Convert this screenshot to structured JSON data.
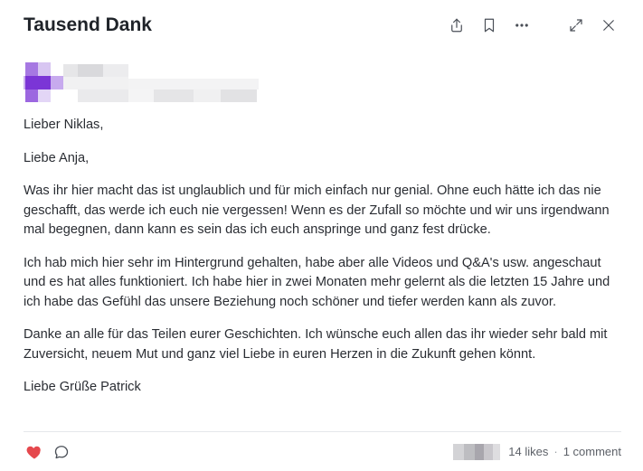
{
  "post": {
    "title": "Tausend Dank",
    "greetings": [
      "Lieber Niklas,",
      "Liebe Anja,"
    ],
    "paragraphs": [
      "Was ihr hier macht das ist unglaublich und für mich einfach nur genial. Ohne euch hätte ich das nie geschafft, das werde ich euch nie vergessen! Wenn es der Zufall so möchte und wir uns irgendwann mal begegnen, dann kann es sein das ich euch anspringe und ganz fest drücke.",
      "Ich hab mich hier sehr im Hintergrund gehalten, habe aber alle Videos und Q&A's usw. angeschaut und es hat alles funktioniert. Ich habe hier in zwei Monaten mehr gelernt als die letzten 15 Jahre und ich habe das Gefühl das unsere Beziehung noch schöner und tiefer werden kann als zuvor.",
      "Danke an alle für das Teilen eurer Geschichten. Ich wünsche euch allen das ihr wieder sehr bald mit Zuversicht, neuem Mut und ganz viel Liebe in euren Herzen in die Zukunft gehen könnt."
    ],
    "signoff": "Liebe Grüße Patrick"
  },
  "header": {
    "icons": [
      "share-icon",
      "bookmark-icon",
      "more-icon",
      "expand-icon",
      "close-icon"
    ]
  },
  "footer": {
    "likes": "14 likes",
    "separator": "·",
    "comments": "1 comment",
    "icons": [
      "heart-icon",
      "comment-icon"
    ]
  },
  "colors": {
    "accent_purple": "#7b35d6",
    "like_red": "#e5484d",
    "text": "#2a2d33"
  }
}
